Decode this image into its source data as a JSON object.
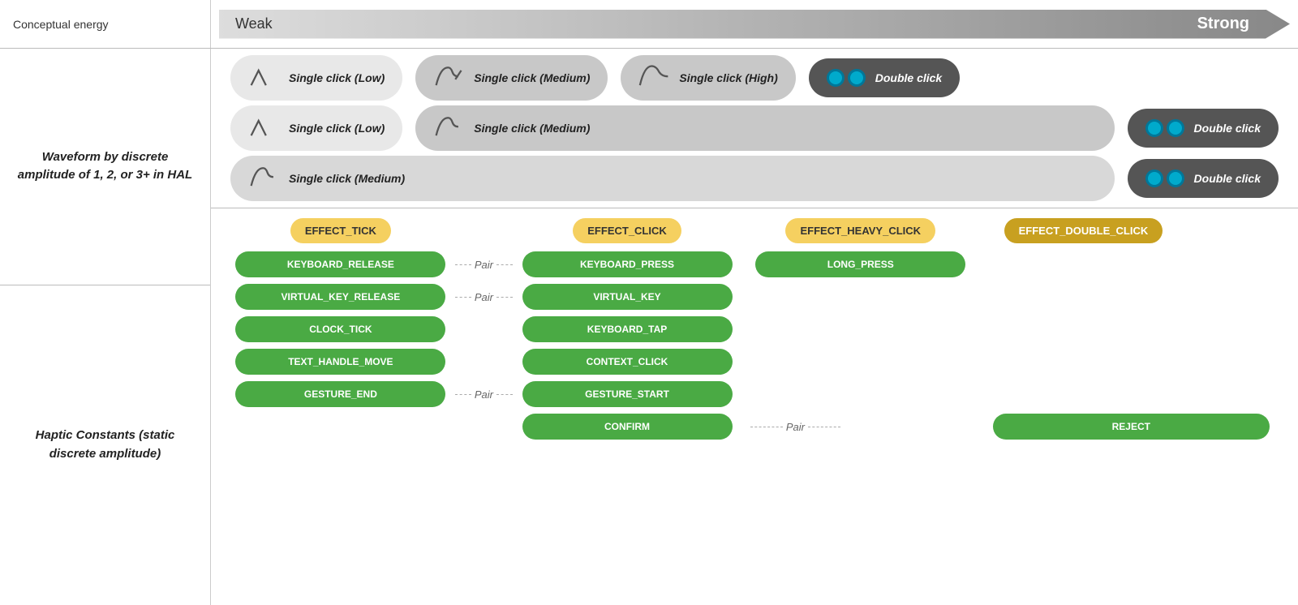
{
  "energy": {
    "label": "Conceptual energy",
    "weak": "Weak",
    "strong": "Strong"
  },
  "waveform": {
    "label": "Waveform by discrete amplitude of 1, 2, or 3+ in HAL",
    "row1": [
      {
        "text": "Single click (Low)",
        "style": "light"
      },
      {
        "text": "Single click (Medium)",
        "style": "medium"
      },
      {
        "text": "Single click (High)",
        "style": "medium"
      },
      {
        "text": "Double click",
        "style": "dark"
      }
    ],
    "row2": [
      {
        "text": "Single click (Low)",
        "style": "light"
      },
      {
        "text": "Single click (Medium)",
        "style": "medium"
      },
      {
        "text": "Double click",
        "style": "dark"
      }
    ],
    "row3": [
      {
        "text": "Single click (Medium)",
        "style": "medium"
      },
      {
        "text": "Double click",
        "style": "dark"
      }
    ]
  },
  "haptic": {
    "label": "Haptic Constants (static discrete amplitude)",
    "effects": [
      {
        "text": "EFFECT_TICK",
        "style": "yellow"
      },
      {
        "text": "EFFECT_CLICK",
        "style": "yellow"
      },
      {
        "text": "EFFECT_HEAVY_CLICK",
        "style": "yellow"
      },
      {
        "text": "EFFECT_DOUBLE_CLICK",
        "style": "gold"
      }
    ],
    "col1": [
      "KEYBOARD_RELEASE",
      "VIRTUAL_KEY_RELEASE",
      "CLOCK_TICK",
      "TEXT_HANDLE_MOVE",
      "GESTURE_END"
    ],
    "col2": [
      "KEYBOARD_PRESS",
      "VIRTUAL_KEY",
      "KEYBOARD_TAP",
      "CONTEXT_CLICK",
      "GESTURE_START",
      "CONFIRM"
    ],
    "col3": [
      "LONG_PRESS"
    ],
    "col4": [
      "REJECT"
    ],
    "pairs": {
      "keyboard": "Pair",
      "virtual": "Pair",
      "gesture": "Pair",
      "confirm_reject": "Pair"
    }
  }
}
